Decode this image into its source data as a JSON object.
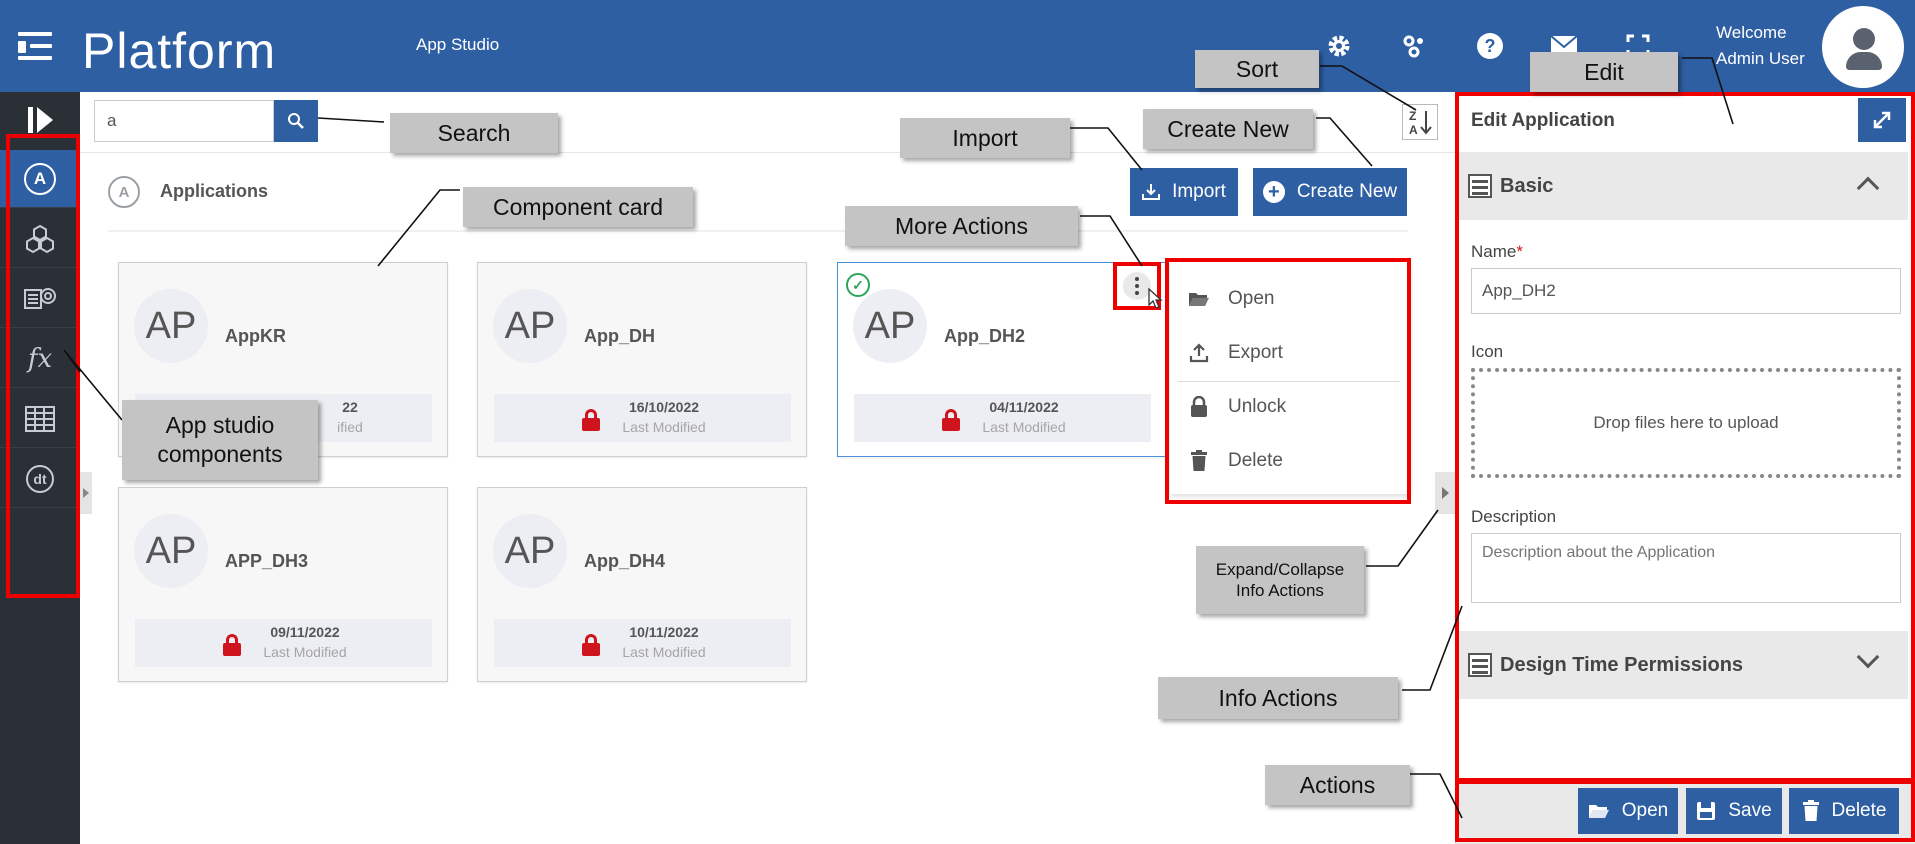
{
  "header": {
    "brand": "Platform",
    "section": "App Studio",
    "welcome_line1": "Welcome",
    "welcome_line2": "Admin User",
    "icons": [
      "settings-gear-icon",
      "integrations-icon",
      "help-icon",
      "mail-icon",
      "fullscreen-icon"
    ]
  },
  "sidebar": {
    "items": [
      {
        "name": "applications",
        "icon": "A"
      },
      {
        "name": "components",
        "icon": "hexagons"
      },
      {
        "name": "devices",
        "icon": "devices"
      },
      {
        "name": "functions",
        "icon": "fx"
      },
      {
        "name": "tables",
        "icon": "table"
      },
      {
        "name": "datatypes",
        "icon": "dt"
      }
    ]
  },
  "search": {
    "value": "a"
  },
  "toolbar": {
    "import_label": "Import",
    "create_label": "Create New"
  },
  "applications": {
    "title": "Applications",
    "icon_letter": "A"
  },
  "cards": [
    {
      "initials": "AP",
      "name": "AppKR",
      "date": "22",
      "modified": "ified"
    },
    {
      "initials": "AP",
      "name": "App_DH",
      "date": "16/10/2022",
      "modified": "Last Modified"
    },
    {
      "initials": "AP",
      "name": "App_DH2",
      "date": "04/11/2022",
      "modified": "Last Modified"
    },
    {
      "initials": "AP",
      "name": "APP_DH3",
      "date": "09/11/2022",
      "modified": "Last Modified"
    },
    {
      "initials": "AP",
      "name": "App_DH4",
      "date": "10/11/2022",
      "modified": "Last Modified"
    }
  ],
  "context_menu": {
    "open": "Open",
    "export": "Export",
    "unlock": "Unlock",
    "delete": "Delete"
  },
  "panel": {
    "title": "Edit Application",
    "basic_section": "Basic",
    "name_label": "Name",
    "name_required": "*",
    "name_value": "App_DH2",
    "icon_label": "Icon",
    "dropzone_text": "Drop files here to upload",
    "description_label": "Description",
    "description_placeholder": "Description about the Application",
    "permissions_section": "Design Time Permissions",
    "open_label": "Open",
    "save_label": "Save",
    "delete_label": "Delete"
  },
  "callouts": {
    "sort": "Sort",
    "edit": "Edit",
    "search": "Search",
    "import": "Import",
    "create_new": "Create New",
    "component_card": "Component card",
    "more_actions": "More Actions",
    "app_studio_components_1": "App studio",
    "app_studio_components_2": "components",
    "expand_collapse_1": "Expand/Collapse",
    "expand_collapse_2": "Info Actions",
    "info_actions": "Info Actions",
    "actions": "Actions"
  },
  "colors": {
    "primary": "#2e5fa3",
    "sidebar": "#2b2f36",
    "lock": "#d0141e",
    "annotation": "#c4c4c4",
    "highlight": "#e00"
  }
}
